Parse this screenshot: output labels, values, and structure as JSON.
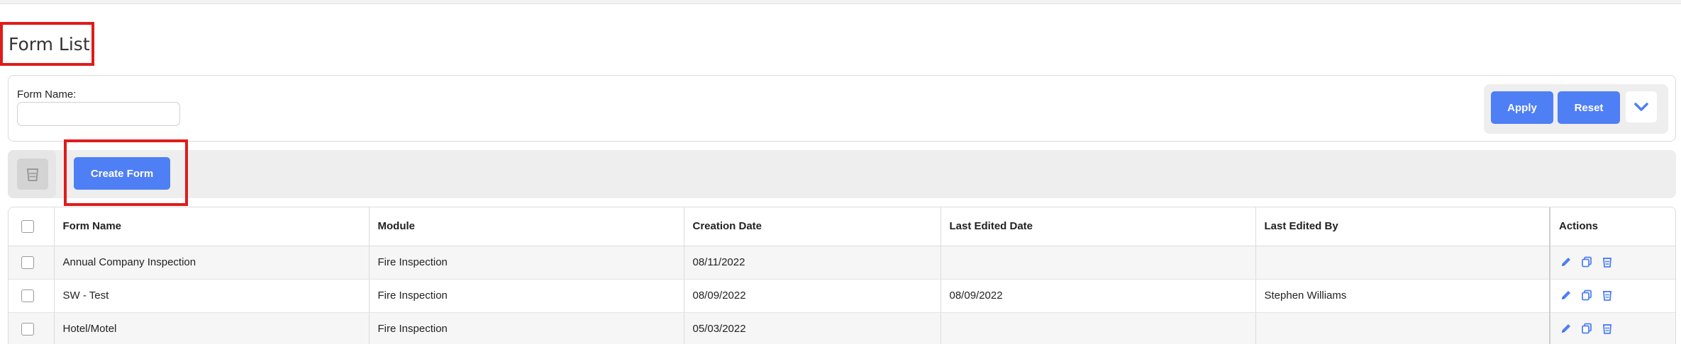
{
  "page": {
    "title": "Form List"
  },
  "filter": {
    "form_name_label": "Form Name:",
    "form_name_value": "",
    "apply_label": "Apply",
    "reset_label": "Reset",
    "toggle_icon": "chevron-down-icon"
  },
  "toolbar": {
    "delete_icon": "trash-icon",
    "create_label": "Create Form"
  },
  "table": {
    "columns": [
      "Form Name",
      "Module",
      "Creation Date",
      "Last Edited Date",
      "Last Edited By",
      "Actions"
    ],
    "rows": [
      {
        "name": "Annual Company Inspection",
        "module": "Fire Inspection",
        "created": "08/11/2022",
        "edited": "",
        "edited_by": ""
      },
      {
        "name": "SW - Test",
        "module": "Fire Inspection",
        "created": "08/09/2022",
        "edited": "08/09/2022",
        "edited_by": "Stephen Williams"
      },
      {
        "name": "Hotel/Motel",
        "module": "Fire Inspection",
        "created": "05/03/2022",
        "edited": "",
        "edited_by": ""
      }
    ],
    "action_icons": [
      "pencil-icon",
      "copy-icon",
      "trash-icon"
    ]
  },
  "colors": {
    "primary": "#4f7ff5",
    "highlight": "#e01b1b",
    "panel": "#eeeeee"
  }
}
